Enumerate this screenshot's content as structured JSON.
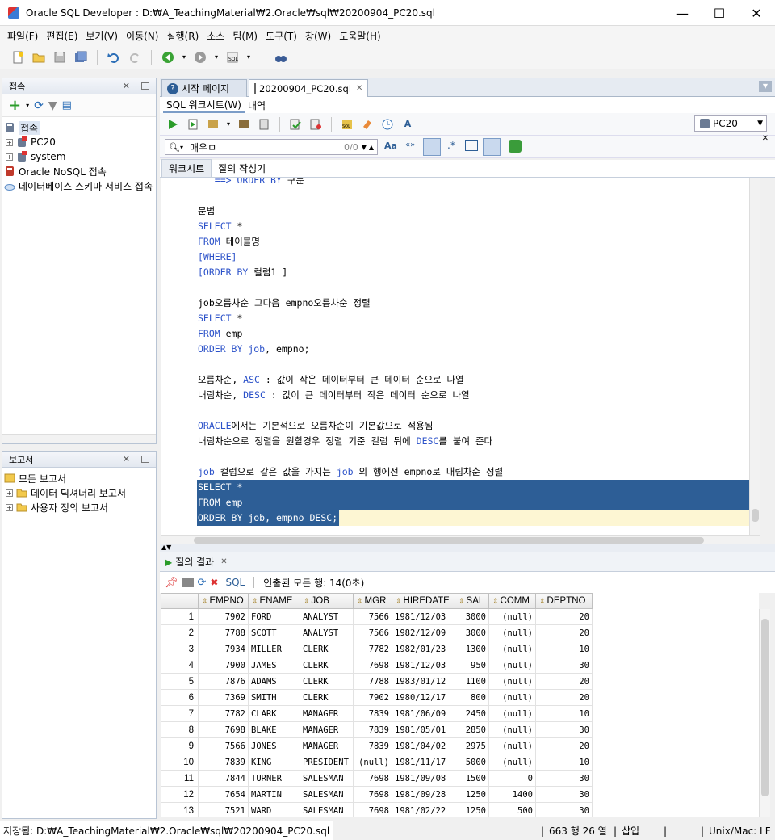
{
  "window": {
    "title": "Oracle SQL Developer : D:₩A_TeachingMaterial₩2.Oracle₩sql₩20200904_PC20.sql",
    "min": "—",
    "max": "☐",
    "close": "✕"
  },
  "menu": [
    "파일(F)",
    "편집(E)",
    "보기(V)",
    "이동(N)",
    "실행(R)",
    "소스",
    "팀(M)",
    "도구(T)",
    "창(W)",
    "도움말(H)"
  ],
  "connections_panel": {
    "title": "접속",
    "items": [
      {
        "label": "접속",
        "level": 0
      },
      {
        "label": "PC20",
        "level": 1
      },
      {
        "label": "system",
        "level": 1
      },
      {
        "label": "Oracle NoSQL 접속",
        "level": 0
      },
      {
        "label": "데이터베이스 스키마 서비스 접속",
        "level": 0
      }
    ]
  },
  "reports_panel": {
    "title": "보고서",
    "items": [
      {
        "label": "모든 보고서",
        "level": 0
      },
      {
        "label": "데이터 딕셔너리 보고서",
        "level": 1
      },
      {
        "label": "사용자 정의 보고서",
        "level": 1
      }
    ]
  },
  "editor_tabs": [
    {
      "label": "시작 페이지"
    },
    {
      "label": "20200904_PC20.sql"
    }
  ],
  "sub_tabs": [
    "SQL 워크시트(W)",
    "내역"
  ],
  "connection_selector": "PC20",
  "find": {
    "query": "매우ㅁ",
    "count": "0/0"
  },
  "worksheet_tabs": [
    "워크시트",
    "질의 작성기"
  ],
  "code_lines": [
    {
      "text": "   ==> ORDER BY 구문",
      "partial": true
    },
    {
      "text": ""
    },
    {
      "text": "문법"
    },
    {
      "text": "SELECT *"
    },
    {
      "text": "FROM 테이블명"
    },
    {
      "text": "[WHERE]"
    },
    {
      "text": "[ORDER BY 컬럼1 ]"
    },
    {
      "text": ""
    },
    {
      "text": "job오름차순 그다음 empno오름차순 정렬"
    },
    {
      "text": "SELECT *"
    },
    {
      "text": "FROM emp"
    },
    {
      "text": "ORDER BY job, empno;"
    },
    {
      "text": ""
    },
    {
      "text": "오름차순, ASC : 값이 작은 데이터부터 큰 데이터 순으로 나열"
    },
    {
      "text": "내림차순, DESC : 값이 큰 데이터부터 작은 데이터 순으로 나열"
    },
    {
      "text": ""
    },
    {
      "text": "ORACLE에서는 기본적으로 오름차순이 기본값으로 적용됨"
    },
    {
      "text": "내림차순으로 정렬을 원할경우 정렬 기준 컬럼 뒤에 DESC를 붙여 준다"
    },
    {
      "text": ""
    },
    {
      "text": "job 컬럼으로 같은 값을 가지는 job 의 행에선 empno로 내림차순 정렬"
    },
    {
      "text": "SELECT *",
      "selected": true
    },
    {
      "text": "FROM emp",
      "selected": true
    },
    {
      "text": "ORDER BY job, empno DESC;",
      "selected": true
    }
  ],
  "results": {
    "tab": "질의 결과",
    "sql_link": "SQL",
    "status": "인출된 모든 행: 14(0초)",
    "columns": [
      "EMPNO",
      "ENAME",
      "JOB",
      "MGR",
      "HIREDATE",
      "SAL",
      "COMM",
      "DEPTNO"
    ],
    "rows": [
      [
        "1",
        "7902",
        "FORD",
        "ANALYST",
        "7566",
        "1981/12/03",
        "3000",
        "(null)",
        "20"
      ],
      [
        "2",
        "7788",
        "SCOTT",
        "ANALYST",
        "7566",
        "1982/12/09",
        "3000",
        "(null)",
        "20"
      ],
      [
        "3",
        "7934",
        "MILLER",
        "CLERK",
        "7782",
        "1982/01/23",
        "1300",
        "(null)",
        "10"
      ],
      [
        "4",
        "7900",
        "JAMES",
        "CLERK",
        "7698",
        "1981/12/03",
        "950",
        "(null)",
        "30"
      ],
      [
        "5",
        "7876",
        "ADAMS",
        "CLERK",
        "7788",
        "1983/01/12",
        "1100",
        "(null)",
        "20"
      ],
      [
        "6",
        "7369",
        "SMITH",
        "CLERK",
        "7902",
        "1980/12/17",
        "800",
        "(null)",
        "20"
      ],
      [
        "7",
        "7782",
        "CLARK",
        "MANAGER",
        "7839",
        "1981/06/09",
        "2450",
        "(null)",
        "10"
      ],
      [
        "8",
        "7698",
        "BLAKE",
        "MANAGER",
        "7839",
        "1981/05/01",
        "2850",
        "(null)",
        "30"
      ],
      [
        "9",
        "7566",
        "JONES",
        "MANAGER",
        "7839",
        "1981/04/02",
        "2975",
        "(null)",
        "20"
      ],
      [
        "10",
        "7839",
        "KING",
        "PRESIDENT",
        "(null)",
        "1981/11/17",
        "5000",
        "(null)",
        "10"
      ],
      [
        "11",
        "7844",
        "TURNER",
        "SALESMAN",
        "7698",
        "1981/09/08",
        "1500",
        "0",
        "30"
      ],
      [
        "12",
        "7654",
        "MARTIN",
        "SALESMAN",
        "7698",
        "1981/09/28",
        "1250",
        "1400",
        "30"
      ],
      [
        "13",
        "7521",
        "WARD",
        "SALESMAN",
        "7698",
        "1981/02/22",
        "1250",
        "500",
        "30"
      ]
    ]
  },
  "statusbar": {
    "path": "저장됨: D:₩A_TeachingMaterial₩2.Oracle₩sql₩20200904_PC20.sql",
    "position": "663 행 26 열",
    "mode": "삽입",
    "eol": "Unix/Mac: LF"
  },
  "colors": {
    "keyword": "#2c52c9",
    "selection": "#2d5e96",
    "cursor_line": "#fdf6d3"
  }
}
